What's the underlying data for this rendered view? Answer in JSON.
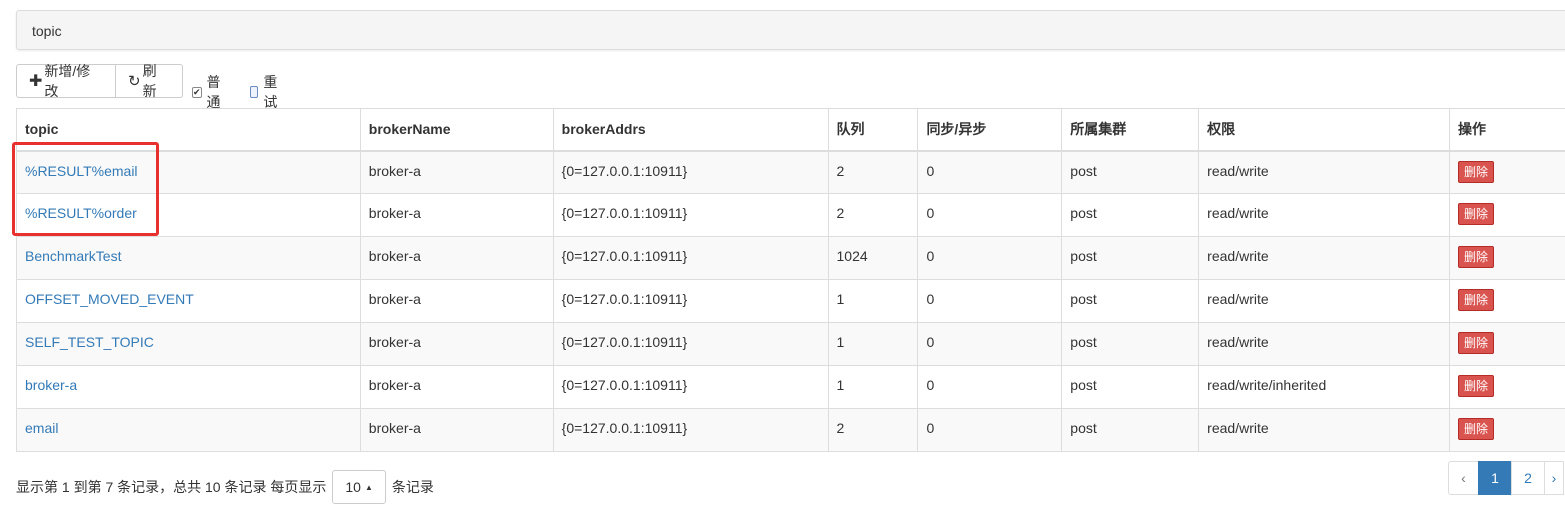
{
  "panel": {
    "title": "topic"
  },
  "toolbar": {
    "add_label": "新增/修改",
    "refresh_label": "刷新",
    "filter_normal": {
      "label": "普通",
      "checked": true
    },
    "filter_retry": {
      "label": "重试",
      "checked": false
    }
  },
  "table": {
    "columns": [
      "topic",
      "brokerName",
      "brokerAddrs",
      "队列",
      "同步/异步",
      "所属集群",
      "权限",
      "操作"
    ],
    "rows": [
      {
        "topic": "%RESULT%email",
        "brokerName": "broker-a",
        "brokerAddrs": "{0=127.0.0.1:10911}",
        "queues": "2",
        "sync": "0",
        "cluster": "post",
        "perm": "read/write",
        "action": "删除"
      },
      {
        "topic": "%RESULT%order",
        "brokerName": "broker-a",
        "brokerAddrs": "{0=127.0.0.1:10911}",
        "queues": "2",
        "sync": "0",
        "cluster": "post",
        "perm": "read/write",
        "action": "删除"
      },
      {
        "topic": "BenchmarkTest",
        "brokerName": "broker-a",
        "brokerAddrs": "{0=127.0.0.1:10911}",
        "queues": "1024",
        "sync": "0",
        "cluster": "post",
        "perm": "read/write",
        "action": "删除"
      },
      {
        "topic": "OFFSET_MOVED_EVENT",
        "brokerName": "broker-a",
        "brokerAddrs": "{0=127.0.0.1:10911}",
        "queues": "1",
        "sync": "0",
        "cluster": "post",
        "perm": "read/write",
        "action": "删除"
      },
      {
        "topic": "SELF_TEST_TOPIC",
        "brokerName": "broker-a",
        "brokerAddrs": "{0=127.0.0.1:10911}",
        "queues": "1",
        "sync": "0",
        "cluster": "post",
        "perm": "read/write",
        "action": "删除"
      },
      {
        "topic": "broker-a",
        "brokerName": "broker-a",
        "brokerAddrs": "{0=127.0.0.1:10911}",
        "queues": "1",
        "sync": "0",
        "cluster": "post",
        "perm": "read/write/inherited",
        "action": "删除"
      },
      {
        "topic": "email",
        "brokerName": "broker-a",
        "brokerAddrs": "{0=127.0.0.1:10911}",
        "queues": "2",
        "sync": "0",
        "cluster": "post",
        "perm": "read/write",
        "action": "删除"
      }
    ]
  },
  "footer": {
    "info_text": "显示第 1 到第 7 条记录，总共 10 条记录 每页显示",
    "page_size": "10",
    "suffix": "条记录"
  },
  "pagination": {
    "prev": "‹",
    "pages": [
      "1",
      "2"
    ],
    "active": "1",
    "next": "›"
  },
  "colors": {
    "link": "#337ab7",
    "danger": "#d9534f",
    "highlight": "#e8312f"
  }
}
